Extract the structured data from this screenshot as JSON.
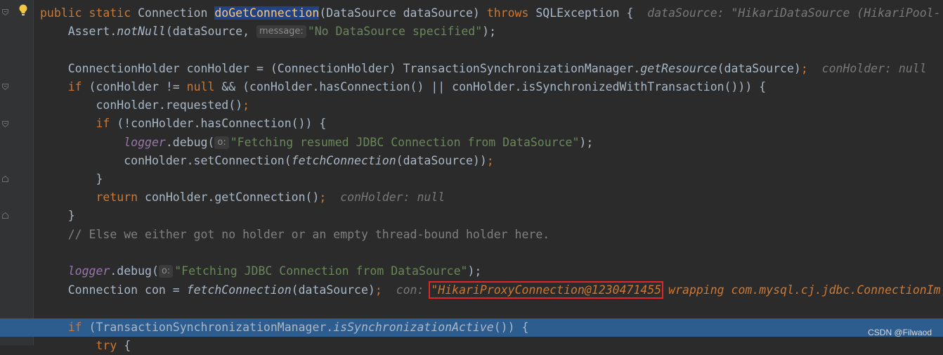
{
  "watermark": "CSDN @Filwaod",
  "code": {
    "l1": {
      "kw1": "public static",
      "type": "Connection",
      "method": "doGetConnection",
      "params": "(DataSource dataSource)",
      "kw2": "throws",
      "exc": "SQLException {",
      "dbg": "dataSource: \"HikariDataSource (HikariPool-"
    },
    "l2": {
      "a": "Assert.",
      "b": "notNull",
      "c": "(dataSource,",
      "hint": "message:",
      "str": "\"No DataSource specified\"",
      "end": ");"
    },
    "l3": {
      "a": "ConnectionHolder conHolder = (ConnectionHolder) TransactionSynchronizationManager.",
      "b": "getResource",
      "c": "(dataSource)",
      "semi": ";",
      "dbg": "conHolder: null"
    },
    "l4": {
      "kw1": "if",
      "a": " (conHolder != ",
      "kw2": "null",
      "b": " && (conHolder.hasConnection() || conHolder.isSynchronizedWithTransaction())) {"
    },
    "l5": {
      "a": "conHolder.requested()",
      "semi": ";"
    },
    "l6": {
      "kw": "if",
      "a": " (!conHolder.hasConnection()) {"
    },
    "l7": {
      "field": "logger",
      "a": ".debug(",
      "hint": "o:",
      "str": "\"Fetching resumed JDBC Connection from DataSource\"",
      "end": ");"
    },
    "l8": {
      "a": "conHolder.setConnection(",
      "b": "fetchConnection",
      "c": "(dataSource))",
      "semi": ";"
    },
    "l9": {
      "a": "}"
    },
    "l10": {
      "kw": "return",
      "a": " conHolder.getConnection()",
      "semi": ";",
      "dbg": "conHolder: null"
    },
    "l11": {
      "a": "}"
    },
    "l12": {
      "cm": "// Else we either got no holder or an empty thread-bound holder here."
    },
    "l13": {
      "field": "logger",
      "a": ".debug(",
      "hint": "o:",
      "str": "\"Fetching JDBC Connection from DataSource\"",
      "end": ");"
    },
    "l14": {
      "a": "Connection con = ",
      "b": "fetchConnection",
      "c": "(dataSource)",
      "semi": ";",
      "dbg_label": "con:",
      "dbg_val": "\"HikariProxyConnection@1230471455",
      "dbg_rest": "wrapping com.mysql.cj.jdbc.ConnectionIm"
    },
    "l15": {
      "kw": "if",
      "a": " (TransactionSynchronizationManager.",
      "b": "isSynchronizationActive",
      "c": "()) {"
    },
    "l16": {
      "kw": "try",
      "a": " {"
    }
  }
}
